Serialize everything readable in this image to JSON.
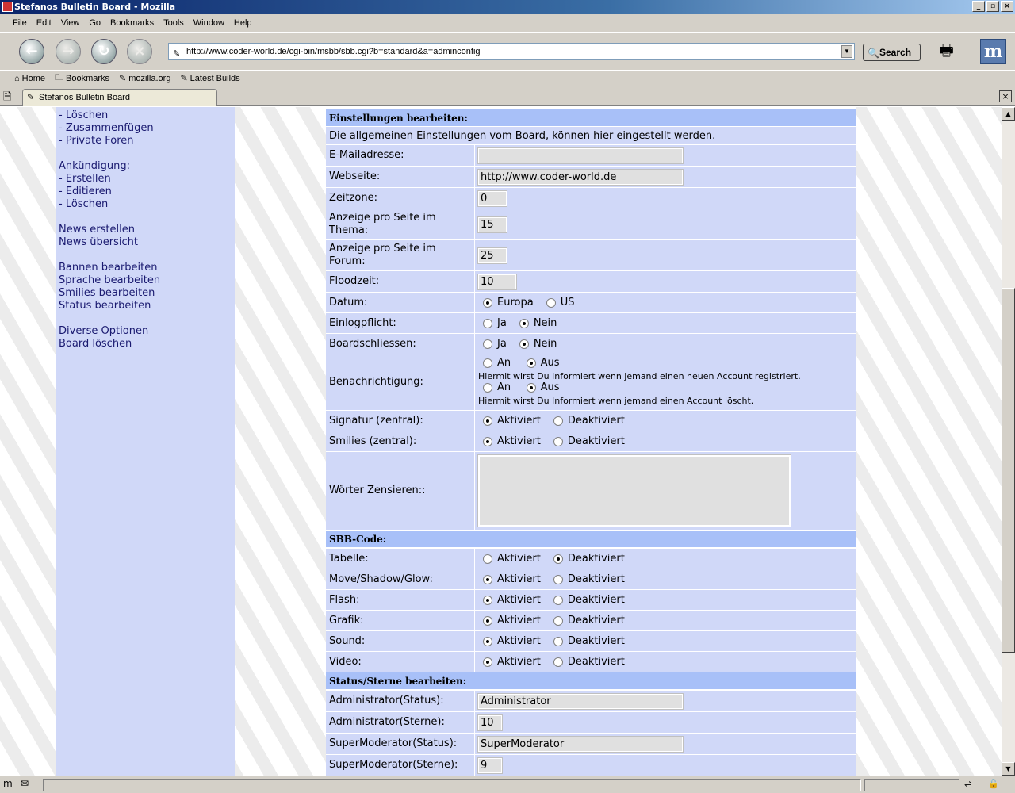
{
  "window": {
    "title": "Stefanos Bulletin Board - Mozilla",
    "min": "_",
    "max": "▫",
    "close": "×"
  },
  "menu": [
    "File",
    "Edit",
    "View",
    "Go",
    "Bookmarks",
    "Tools",
    "Window",
    "Help"
  ],
  "nav": {
    "url": "http://www.coder-world.de/cgi-bin/msbb/sbb.cgi?b=standard&a=adminconfig",
    "search_label": "Search"
  },
  "bookmarks": [
    "Home",
    "Bookmarks",
    "mozilla.org",
    "Latest Builds"
  ],
  "tab": {
    "title": "Stefanos Bulletin Board"
  },
  "sidebar": {
    "items": [
      "- Löschen",
      "- Zusammenfügen",
      "- Private Foren",
      "Ankündigung:",
      "- Erstellen",
      "- Editieren",
      "- Löschen",
      "News erstellen",
      "News übersicht",
      "Bannen bearbeiten",
      "Sprache bearbeiten",
      "Smilies bearbeiten",
      "Status bearbeiten",
      "Diverse Optionen",
      "Board löschen"
    ]
  },
  "settings": {
    "header": "Einstellungen bearbeiten:",
    "intro": "Die allgemeinen Einstellungen vom Board, können hier eingestellt werden.",
    "email_label": "E-Mailadresse:",
    "email_value": "",
    "website_label": "Webseite:",
    "website_value": "http://www.coder-world.de",
    "timezone_label": "Zeitzone:",
    "timezone_value": "0",
    "per_topic_label": "Anzeige pro Seite im Thema:",
    "per_topic_value": "15",
    "per_forum_label": "Anzeige pro Seite im Forum:",
    "per_forum_value": "25",
    "flood_label": "Floodzeit:",
    "flood_value": "10",
    "date_label": "Datum:",
    "date_opt1": "Europa",
    "date_opt2": "US",
    "login_label": "Einlogpflicht:",
    "close_label": "Boardschliessen:",
    "yes": "Ja",
    "no": "Nein",
    "notify_label": "Benachrichtigung:",
    "on": "An",
    "off": "Aus",
    "notify_text1": "Hiermit wirst Du Informiert wenn jemand einen neuen Account registriert.",
    "notify_text2": "Hiermit wirst Du Informiert wenn jemand einen Account löscht.",
    "signature_label": "Signatur (zentral):",
    "smilies_label": "Smilies (zentral):",
    "activated": "Aktiviert",
    "deactivated": "Deaktiviert",
    "censor_label": "Wörter Zensieren::"
  },
  "sbb": {
    "header": "SBB-Code:",
    "table_label": "Tabelle:",
    "move_label": "Move/Shadow/Glow:",
    "flash_label": "Flash:",
    "image_label": "Grafik:",
    "sound_label": "Sound:",
    "video_label": "Video:"
  },
  "status": {
    "header": "Status/Sterne bearbeiten:",
    "admin_status_label": "Administrator(Status):",
    "admin_status_value": "Administrator",
    "admin_stars_label": "Administrator(Sterne):",
    "admin_stars_value": "10",
    "smod_status_label": "SuperModerator(Status):",
    "smod_status_value": "SuperModerator",
    "smod_stars_label": "SuperModerator(Sterne):",
    "smod_stars_value": "9"
  },
  "colors": {
    "row_bg": "#d0d8f8",
    "header_bg": "#a8c0f8",
    "chrome": "#d4d0c8"
  }
}
